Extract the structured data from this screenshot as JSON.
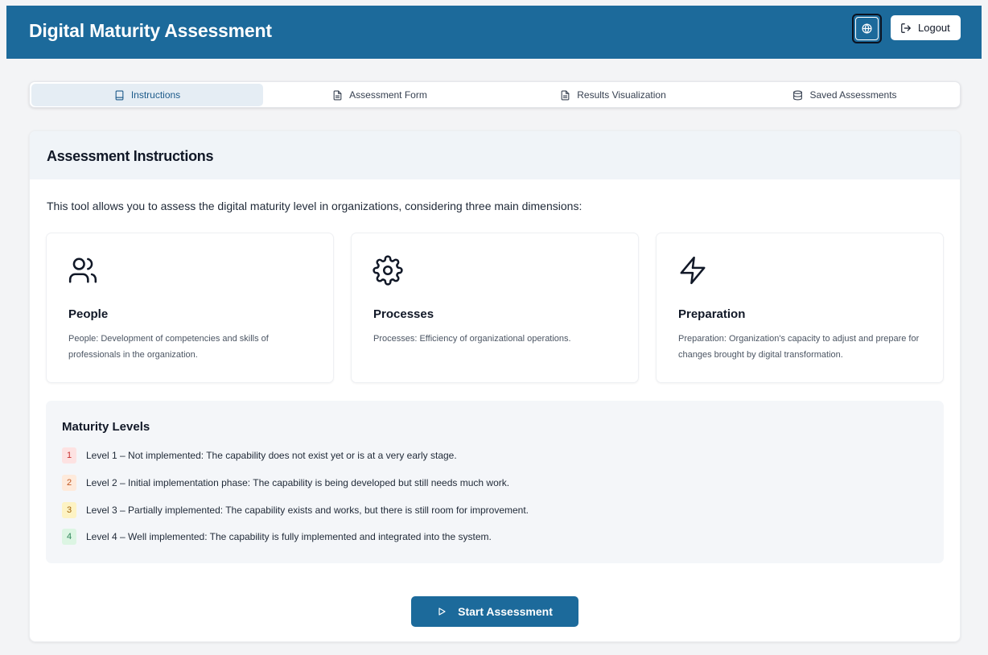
{
  "header": {
    "title": "Digital Maturity Assessment",
    "logout_label": "Logout"
  },
  "tabs": [
    {
      "label": "Instructions",
      "icon": "tablet-icon",
      "active": true
    },
    {
      "label": "Assessment Form",
      "icon": "file-text-icon",
      "active": false
    },
    {
      "label": "Results Visualization",
      "icon": "file-text-icon",
      "active": false
    },
    {
      "label": "Saved Assessments",
      "icon": "database-icon",
      "active": false
    }
  ],
  "instructions": {
    "title": "Assessment Instructions",
    "intro": "This tool allows you to assess the digital maturity level in organizations, considering three main dimensions:",
    "dimensions": [
      {
        "title": "People",
        "icon": "users-icon",
        "description": "People: Development of competencies and skills of professionals in the organization."
      },
      {
        "title": "Processes",
        "icon": "gear-icon",
        "description": "Processes: Efficiency of organizational operations."
      },
      {
        "title": "Preparation",
        "icon": "lightning-icon",
        "description": "Preparation: Organization's capacity to adjust and prepare for changes brought by digital transformation."
      }
    ],
    "levels_title": "Maturity Levels",
    "levels": [
      {
        "num": "1",
        "text": "Level 1 – Not implemented: The capability does not exist yet or is at a very early stage.",
        "bg": "#fde2e2",
        "fg": "#c53030"
      },
      {
        "num": "2",
        "text": "Level 2 – Initial implementation phase: The capability is being developed but still needs much work.",
        "bg": "#feeadb",
        "fg": "#c05621"
      },
      {
        "num": "3",
        "text": "Level 3 – Partially implemented: The capability exists and works, but there is still room for improvement.",
        "bg": "#fdf3c4",
        "fg": "#a16207"
      },
      {
        "num": "4",
        "text": "Level 4 – Well implemented: The capability is fully implemented and integrated into the system.",
        "bg": "#dcf5e3",
        "fg": "#2f855a"
      }
    ],
    "start_label": "Start Assessment"
  },
  "colors": {
    "brand": "#1c6a9b",
    "header_bg": "#1c6a9b"
  }
}
